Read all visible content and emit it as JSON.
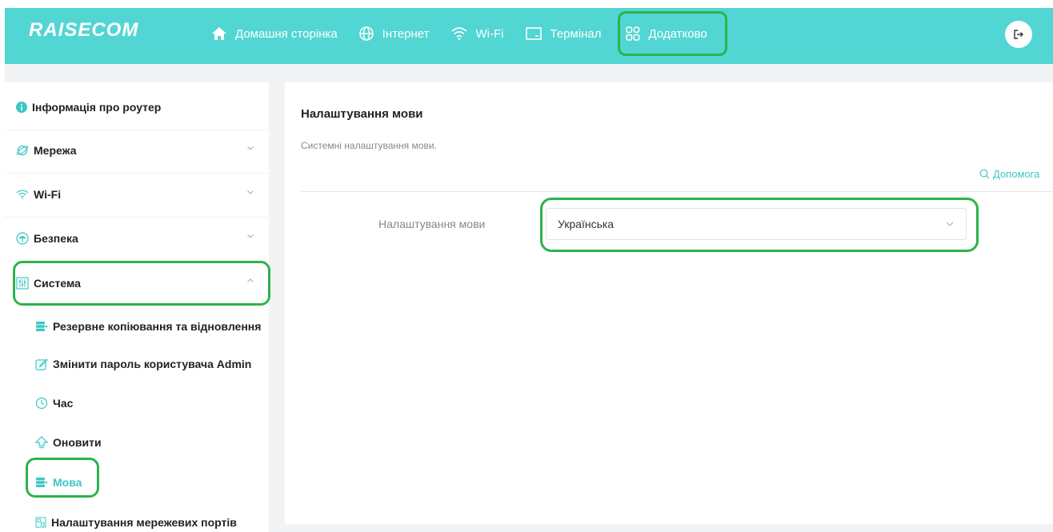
{
  "brand": {
    "logo_text": "RAISECOM"
  },
  "nav": {
    "items": [
      {
        "label": "Домашня сторінка",
        "icon": "home-icon"
      },
      {
        "label": "Інтернет",
        "icon": "globe-icon"
      },
      {
        "label": "Wi-Fi",
        "icon": "wifi-icon"
      },
      {
        "label": "Термінал",
        "icon": "monitor-icon"
      },
      {
        "label": "Додатково",
        "icon": "apps-icon"
      }
    ],
    "logout_icon": "logout-icon"
  },
  "sidebar": {
    "items": [
      {
        "label": "Інформація про роутер",
        "icon": "info-icon"
      },
      {
        "label": "Мережа",
        "icon": "network-icon"
      },
      {
        "label": "Wi-Fi",
        "icon": "wifi-icon"
      },
      {
        "label": "Безпека",
        "icon": "shield-icon"
      },
      {
        "label": "Система",
        "icon": "system-icon"
      }
    ],
    "subitems": [
      {
        "label": "Резервне копіювання та відновлення",
        "icon": "database-icon"
      },
      {
        "label": "Змінити пароль користувача Admin",
        "icon": "edit-icon"
      },
      {
        "label": "Час",
        "icon": "clock-icon"
      },
      {
        "label": "Оновити",
        "icon": "upgrade-icon"
      },
      {
        "label": "Мова",
        "icon": "database-icon",
        "active": true
      },
      {
        "label": "Налаштування мережевих портів",
        "icon": "ports-icon"
      }
    ]
  },
  "main": {
    "title": "Налаштування мови",
    "description": "Системні налаштування мови.",
    "help_label": "Допомога",
    "form": {
      "language_label": "Налаштування мови",
      "language_value": "Українська"
    }
  },
  "colors": {
    "header": "#52d6d3",
    "accent": "#3cc7c4",
    "highlight_outline": "#2db34a",
    "background": "#f2f3f5"
  }
}
